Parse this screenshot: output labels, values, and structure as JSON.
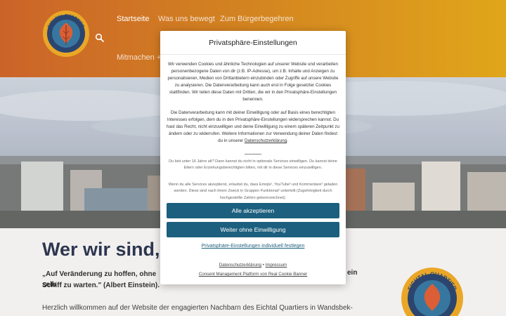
{
  "colors": {
    "header_start": "#c85a1c",
    "header_end": "#dfa10c",
    "primary_button": "#1c5f7e",
    "title": "#1f2a44"
  },
  "header": {
    "logo_top_text": "EICHTAL QUARTIER",
    "logo_bottom_text": "WANDSBEK",
    "search_icon": "search-icon",
    "nav": [
      {
        "label": "Startseite",
        "active": true
      },
      {
        "label": "Was uns bewegt",
        "active": false
      },
      {
        "label": "Zum Bürgerbegehren",
        "active": false
      },
      {
        "label": "Mitmachen + C",
        "active": false
      }
    ]
  },
  "page": {
    "title": "Wer wir sind, w",
    "quote_start": "„Auf Veränderung zu hoffen, ohne selb",
    "quote_tail": "ein",
    "quote_end": "Schiff zu warten.\" (Albert Einstein).",
    "welcome": "Herzlich willkommen auf der Website der engagierten Nachbarn des Eichtal Quartiers in Wandsbek-"
  },
  "modal": {
    "title": "Privatsphäre-Einstellungen",
    "para1": "Wir verwenden Cookies und ähnliche Technologien auf unserer Website und verarbeiten personenbezogene Daten von dir (z.B. IP-Adresse), um z.B. Inhalte und Anzeigen zu personalisieren, Medien von Drittanbietern einzubinden oder Zugriffe auf unsere Website zu analysieren. Die Datenverarbeitung kann auch erst in Folge gesetzter Cookies stattfinden. Wir teilen diese Daten mit Dritten, die wir in den Privatsphäre-Einstellungen benennen.",
    "para2": "Die Datenverarbeitung kann mit deiner Einwilligung oder auf Basis eines berechtigten Interesses erfolgen, dem du in den Privatsphäre-Einstellungen widersprechen kannst. Du hast das Recht, nicht einzuwilligen und deine Einwilligung zu einem späteren Zeitpunkt zu ändern oder zu widerrufen. Weitere Informationen zur Verwendung deiner Daten findest du in unserer",
    "para2_link": "Datenschutzerklärung",
    "para2_end": ".",
    "para3": "Du bist unter 16 Jahre alt? Dann kannst du nicht in optionale Services einwilligen. Du kannst deine Eltern oder Erziehungsberechtigten bitten, mit dir in diese Services einzuwilligen.",
    "para4": "Wenn du alle Services akzeptierst, erlaubst du, dass Emojis¹, YouTube² und Kommentare² geladen werden. Diese sind nach ihrem Zweck in Gruppen Funktional¹ unterteilt (Zugehörigkeit durch hochgestellte Zahlen gekennzeichnet).",
    "accept_all": "Alle akzeptieren",
    "continue_without": "Weiter ohne Einwilligung",
    "customize": "Privatsphäre-Einstellungen individuell festlegen",
    "footer_privacy": "Datenschutzerklärung",
    "footer_sep": "•",
    "footer_imprint": "Impressum",
    "footer_credit": "Consent Management Platform von Real Cookie Banner"
  }
}
